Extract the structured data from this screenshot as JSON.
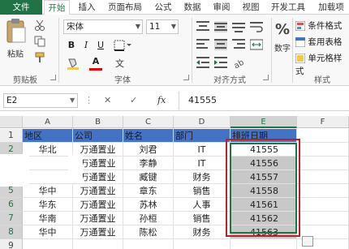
{
  "ribbon_tabs": [
    "文件",
    "开始",
    "插入",
    "页面布局",
    "公式",
    "数据",
    "审阅",
    "视图",
    "开发工具",
    "加载项"
  ],
  "clipboard": {
    "paste_label": "粘贴",
    "group_label": "剪贴板"
  },
  "font": {
    "name": "宋体",
    "size": "11",
    "bold": "B",
    "italic": "I",
    "underline": "U",
    "group_label": "字体",
    "font_color_glyph": "A"
  },
  "alignment": {
    "group_label": "对齐方式"
  },
  "number": {
    "label": "数字",
    "percent_glyph": "%"
  },
  "styles": {
    "conditional_format": "条件格式",
    "table_format": "套用表格",
    "cell_styles": "单元格样式",
    "group_label": "样式"
  },
  "formula_bar": {
    "name_box": "E2",
    "cancel_glyph": "✕",
    "enter_glyph": "✓",
    "fx_glyph": "fx",
    "formula": "41555"
  },
  "columns": [
    "A",
    "B",
    "C",
    "D",
    "E",
    "F"
  ],
  "rows": [
    "1",
    "2",
    "3",
    "4",
    "5",
    "6",
    "7",
    "8",
    "9"
  ],
  "table": {
    "headers": [
      "地区",
      "公司",
      "姓名",
      "部门",
      "排班日期"
    ],
    "data": [
      [
        "华北",
        "万通置业",
        "刘君",
        "IT",
        "41555"
      ],
      [
        "",
        "万通置业",
        "李静",
        "IT",
        "41556"
      ],
      [
        "",
        "万通置业",
        "臧键",
        "财务",
        "41557"
      ],
      [
        "华中",
        "万通置业",
        "章东",
        "销售",
        "41558"
      ],
      [
        "华东",
        "万通置业",
        "苏林",
        "人事",
        "41561"
      ],
      [
        "华南",
        "万通置业",
        "孙桓",
        "销售",
        "41562"
      ],
      [
        "华中",
        "万通置业",
        "陈松",
        "财务",
        "41563"
      ]
    ]
  },
  "colors": {
    "excel_green": "#217346",
    "header_fill": "#4472c4",
    "selection_gray": "#c8c8c8",
    "highlight_red": "#c0202a"
  }
}
